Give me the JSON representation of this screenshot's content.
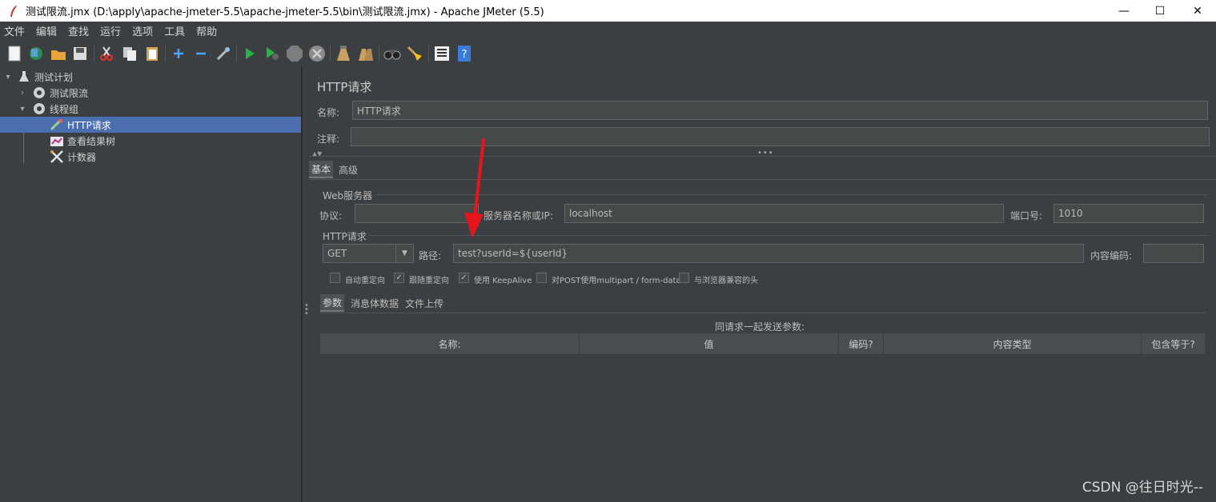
{
  "window": {
    "title": "测试限流.jmx (D:\\apply\\apache-jmeter-5.5\\apache-jmeter-5.5\\bin\\测试限流.jmx) - Apache JMeter (5.5)",
    "minimize": "—",
    "maximize": "☐",
    "close": "✕"
  },
  "menu": [
    "文件",
    "编辑",
    "查找",
    "运行",
    "选项",
    "工具",
    "帮助"
  ],
  "tree": {
    "items": [
      {
        "label": "测试计划",
        "icon": "flask-icon"
      },
      {
        "label": "测试限流",
        "icon": "gear-icon"
      },
      {
        "label": "线程组",
        "icon": "gear-icon"
      },
      {
        "label": "HTTP请求",
        "icon": "pipette-icon"
      },
      {
        "label": "查看结果树",
        "icon": "chart-icon"
      },
      {
        "label": "计数器",
        "icon": "tools-icon"
      }
    ]
  },
  "panel": {
    "title": "HTTP请求",
    "name_label": "名称:",
    "name_value": "HTTP请求",
    "comment_label": "注释:",
    "comment_value": "",
    "tabs": [
      "基本",
      "高级"
    ],
    "web_server": {
      "group_label": "Web服务器",
      "protocol_label": "协议:",
      "protocol_value": "",
      "server_label": "服务器名称或IP:",
      "server_value": "localhost",
      "port_label": "端口号:",
      "port_value": "1010"
    },
    "http_request": {
      "group_label": "HTTP请求",
      "method": "GET",
      "path_label": "路径:",
      "path_value": "test?userId=${userId}",
      "encoding_label": "内容编码:",
      "encoding_value": ""
    },
    "checkboxes": [
      {
        "label": "自动重定向",
        "checked": false
      },
      {
        "label": "跟随重定向",
        "checked": true
      },
      {
        "label": "使用 KeepAlive",
        "checked": true
      },
      {
        "label": "对POST使用multipart / form-data",
        "checked": false
      },
      {
        "label": "与浏览器兼容的头",
        "checked": false
      }
    ],
    "sub_tabs": [
      "参数",
      "消息体数据",
      "文件上传"
    ],
    "params_caption": "同请求一起发送参数:",
    "columns": [
      "名称:",
      "值",
      "编码?",
      "内容类型",
      "包含等于?"
    ]
  },
  "watermark": "CSDN @往日时光--",
  "colors": {
    "background": "#3c3f41",
    "selection": "#4b6eaf",
    "arrow": "#e8141b"
  }
}
